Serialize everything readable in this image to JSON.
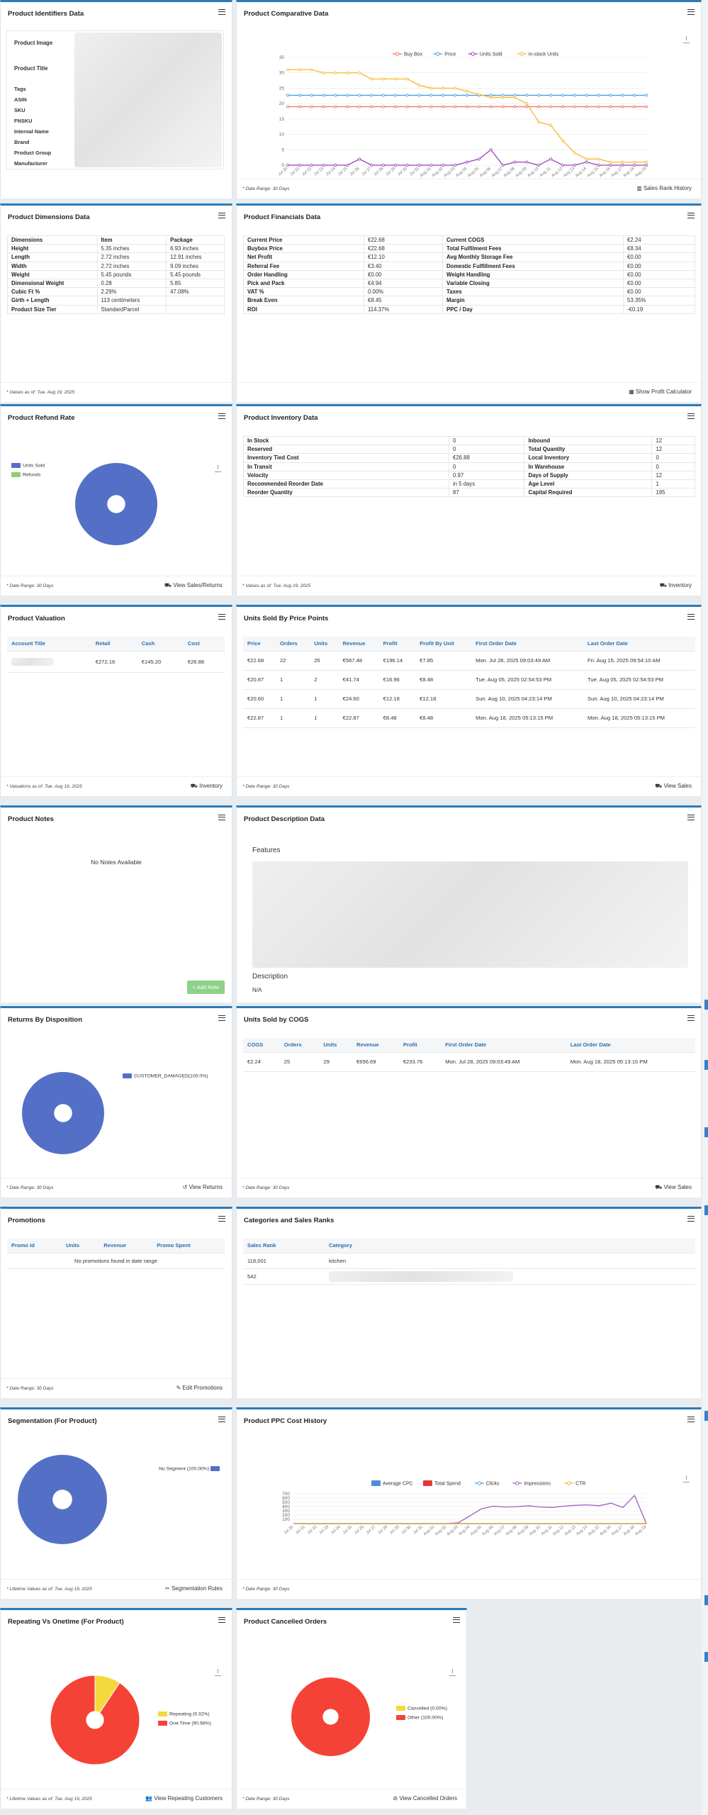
{
  "identifiers": {
    "title": "Product Identifiers Data",
    "image_label": "Product Image",
    "title_label": "Product Title",
    "rows": [
      "Tags",
      "ASIN",
      "SKU",
      "FNSKU",
      "Internal Name",
      "Brand",
      "Product Group",
      "Manufacturer"
    ]
  },
  "comparative": {
    "title": "Product Comparative Data",
    "date_range": "* Date Range: 30 Days",
    "link": "Sales Rank History"
  },
  "dimensions": {
    "title": "Product Dimensions Data",
    "headers": [
      "Dimensions",
      "Item",
      "Package"
    ],
    "rows": [
      [
        "Height",
        "5.35 inches",
        "6.93 inches"
      ],
      [
        "Length",
        "2.72 inches",
        "12.91 inches"
      ],
      [
        "Width",
        "2.72 inches",
        "9.09 inches"
      ],
      [
        "Weight",
        "5.45 pounds",
        "5.45 pounds"
      ],
      [
        "Dimensional Weight",
        "0.28",
        "5.85"
      ],
      [
        "Cubic Ft %",
        "2.29%",
        "47.08%"
      ],
      [
        "Girth + Length",
        "113 centimeters",
        ""
      ],
      [
        "Product Size Tier",
        "StandardParcel",
        ""
      ]
    ],
    "footer": "* Values as of: Tue. Aug 19, 2025"
  },
  "financials": {
    "title": "Product Financials Data",
    "rows": [
      [
        "Current Price",
        "€22.68",
        "Current COGS",
        "€2.24"
      ],
      [
        "Buybox Price",
        "€22.68",
        "Total Fulfilment Fees",
        "€8.34"
      ],
      [
        "Net Profit",
        "€12.10",
        "Avg Monthly Storage Fee",
        "€0.00"
      ],
      [
        "Referral Fee",
        "€3.40",
        "Domestic Fulfillment Fees",
        "€0.00"
      ],
      [
        "Order Handling",
        "€0.00",
        "Weight Handling",
        "€0.00"
      ],
      [
        "Pick and Pack",
        "€4.94",
        "Variable Closing",
        "€0.00"
      ],
      [
        "VAT %",
        "0.00%",
        "Taxes",
        "€0.00"
      ],
      [
        "Break Even",
        "€8.45",
        "Margin",
        "53.35%"
      ],
      [
        "ROI",
        "114.37%",
        "PPC / Day",
        "-€0.19"
      ]
    ],
    "button": "Show Profit Calculator"
  },
  "refund": {
    "title": "Product Refund Rate",
    "legend": [
      "Units Sold",
      "Refunds"
    ],
    "date_range": "* Date Range: 30 Days",
    "button": "View Sales/Returns"
  },
  "inventory": {
    "title": "Product Inventory Data",
    "rows": [
      [
        "In Stock",
        "0",
        "Inbound",
        "12"
      ],
      [
        "Reserved",
        "0",
        "Total Quantity",
        "12"
      ],
      [
        "Inventory Tied Cost",
        "€26.88",
        "Local Inventory",
        "0"
      ],
      [
        "In Transit",
        "0",
        "In Warehouse",
        "0"
      ],
      [
        "Velocity",
        "0.97",
        "Days of Supply",
        "12"
      ],
      [
        "Recommended Reorder Date",
        "in 5 days",
        "Age Level",
        "1"
      ],
      [
        "Reorder Quantity",
        "87",
        "Capital Required",
        "195"
      ]
    ],
    "footer": "* Values as of: Tue. Aug 19, 2025",
    "button": "Inventory"
  },
  "valuation": {
    "title": "Product Valuation",
    "headers": [
      "Account Title",
      "Retail",
      "Cash",
      "Cost"
    ],
    "row": [
      "€272.16",
      "€145.20",
      "€26.88"
    ],
    "footer": "* Valuations as of: Tue. Aug 19, 2025",
    "button": "Inventory"
  },
  "price_points": {
    "title": "Units Sold By Price Points",
    "headers": [
      "Price",
      "Orders",
      "Units",
      "Revenue",
      "Profit",
      "Profit By Unit",
      "First Order Date",
      "Last Order Date"
    ],
    "rows": [
      [
        "€22.68",
        "22",
        "25",
        "€567.48",
        "€196.14",
        "€7.85",
        "Mon. Jul 28, 2025 09:03:49 AM",
        "Fri. Aug 15, 2025 09:54:10 AM"
      ],
      [
        "€20.87",
        "1",
        "2",
        "€41.74",
        "€16.96",
        "€8.48",
        "Tue. Aug 05, 2025 02:54:53 PM",
        "Tue. Aug 05, 2025 02:54:53 PM"
      ],
      [
        "€20.60",
        "1",
        "1",
        "€24.60",
        "€12.18",
        "€12.18",
        "Sun. Aug 10, 2025 04:23:14 PM",
        "Sun. Aug 10, 2025 04:23:14 PM"
      ],
      [
        "€22.87",
        "1",
        "1",
        "€22.87",
        "€8.48",
        "€8.48",
        "Mon. Aug 18, 2025 05:13:15 PM",
        "Mon. Aug 18, 2025 05:13:15 PM"
      ]
    ],
    "date_range": "* Date Range: 30 Days",
    "button": "View Sales"
  },
  "notes": {
    "title": "Product Notes",
    "empty": "No Notes Available",
    "button": "+ Add Note"
  },
  "description": {
    "title": "Product Description Data",
    "features_label": "Features",
    "description_label": "Description",
    "description_value": "N/A"
  },
  "returns": {
    "title": "Returns By Disposition",
    "legend": "CUSTOMER_DAMAGED(100.0%)",
    "date_range": "* Date Range: 30 Days",
    "button": "View Returns"
  },
  "cogs": {
    "title": "Units Sold by COGS",
    "headers": [
      "COGS",
      "Orders",
      "Units",
      "Revenue",
      "Profit",
      "First Order Date",
      "Last Order Date"
    ],
    "row": [
      "€2.24",
      "25",
      "29",
      "€656.69",
      "€233.76",
      "Mon. Jul 28, 2025 09:03:49 AM",
      "Mon. Aug 18, 2025 05:13:15 PM"
    ],
    "date_range": "* Date Range: 30 Days",
    "button": "View Sales"
  },
  "promotions": {
    "title": "Promotions",
    "headers": [
      "Promo Id",
      "Units",
      "Revenue",
      "Promo Spent"
    ],
    "empty": "No promotions found in date range",
    "date_range": "* Date Range: 30 Days",
    "button": "Edit Promotions"
  },
  "categories": {
    "title": "Categories and Sales Ranks",
    "headers": [
      "Sales Rank",
      "Category"
    ],
    "rows": [
      [
        "118,001",
        "kitchen"
      ],
      [
        "542",
        ""
      ]
    ]
  },
  "segmentation": {
    "title": "Segmentation (For Product)",
    "legend": "No Segment (100.00%)",
    "footer": "* Lifetime Values as of: Tue. Aug 19, 2025",
    "button": "Segmentation Rules"
  },
  "ppc": {
    "title": "Product PPC Cost History",
    "legend": [
      "Average CPC",
      "Total Spend",
      "Clicks",
      "Impressions",
      "CTR"
    ],
    "date_range": "* Date Range: 30 Days"
  },
  "repeating": {
    "title": "Repeating Vs Onetime (For Product)",
    "legend": [
      "Repeating (9.32%)",
      "One Time (90.68%)"
    ],
    "footer": "* Lifetime Values as of: Tue. Aug 19, 2025",
    "button": "View Repeating Customers"
  },
  "cancelled": {
    "title": "Product Cancelled Orders",
    "legend": [
      "Cancelled (0.00%)",
      "Other (100.00%)"
    ],
    "date_range": "* Date Range: 30 Days",
    "button": "View Cancelled Orders"
  },
  "chart_data": [
    {
      "type": "line",
      "title": "",
      "x": [
        "Jul 20",
        "Jul 21",
        "Jul 22",
        "Jul 23",
        "Jul 24",
        "Jul 25",
        "Jul 26",
        "Jul 27",
        "Jul 28",
        "Jul 29",
        "Jul 30",
        "Jul 31",
        "Aug 01",
        "Aug 02",
        "Aug 03",
        "Aug 04",
        "Aug 05",
        "Aug 06",
        "Aug 07",
        "Aug 08",
        "Aug 09",
        "Aug 10",
        "Aug 11",
        "Aug 12",
        "Aug 13",
        "Aug 14",
        "Aug 15",
        "Aug 16",
        "Aug 17",
        "Aug 18",
        "Aug 19"
      ],
      "ylim": [
        0,
        35
      ],
      "yticks": [
        0,
        5,
        10,
        15,
        20,
        25,
        30,
        35
      ],
      "series": [
        {
          "name": "Buy Box",
          "color": "#ef6c5a",
          "values": [
            19,
            19,
            19,
            19,
            19,
            19,
            19,
            19,
            19,
            19,
            19,
            19,
            19,
            19,
            19,
            19,
            19,
            19,
            19,
            19,
            19,
            19,
            19,
            19,
            19,
            19,
            19,
            19,
            19,
            19,
            19
          ]
        },
        {
          "name": "Price",
          "color": "#4b9fe0",
          "values": [
            22.7,
            22.7,
            22.7,
            22.7,
            22.7,
            22.7,
            22.7,
            22.7,
            22.7,
            22.7,
            22.7,
            22.7,
            22.7,
            22.7,
            22.7,
            22.7,
            22.7,
            22.7,
            22.7,
            22.7,
            22.7,
            22.7,
            22.7,
            22.7,
            22.7,
            22.7,
            22.7,
            22.7,
            22.7,
            22.7,
            22.7
          ]
        },
        {
          "name": "Units Sold",
          "color": "#9b3fb5",
          "values": [
            0,
            0,
            0,
            0,
            0,
            0,
            2,
            0,
            0,
            0,
            0,
            0,
            0,
            0,
            0,
            1,
            2,
            5,
            0,
            1,
            1,
            0,
            2,
            0,
            0,
            1,
            0,
            0,
            0,
            0,
            0
          ]
        },
        {
          "name": "In-stock Units",
          "color": "#f5b82e",
          "values": [
            31,
            31,
            31,
            30,
            30,
            30,
            30,
            28,
            28,
            28,
            28,
            26,
            25,
            25,
            25,
            24,
            23,
            22,
            22,
            22,
            20,
            14,
            13,
            8,
            4,
            2,
            2,
            1,
            1,
            1,
            1
          ]
        }
      ]
    },
    {
      "type": "pie",
      "title": "",
      "series": [
        {
          "name": "Units Sold",
          "value": 100,
          "color": "#5470c6"
        },
        {
          "name": "Refunds",
          "value": 0,
          "color": "#91cc75"
        }
      ]
    },
    {
      "type": "pie",
      "title": "",
      "series": [
        {
          "name": "CUSTOMER_DAMAGED",
          "value": 100,
          "color": "#5470c6"
        }
      ]
    },
    {
      "type": "pie",
      "title": "",
      "series": [
        {
          "name": "No Segment",
          "value": 100,
          "color": "#5470c6"
        }
      ]
    },
    {
      "type": "line",
      "title": "",
      "x": [
        "Jul 20",
        "Jul 21",
        "Jul 22",
        "Jul 23",
        "Jul 24",
        "Jul 25",
        "Jul 26",
        "Jul 27",
        "Jul 28",
        "Jul 29",
        "Jul 30",
        "Jul 31",
        "Aug 01",
        "Aug 02",
        "Aug 03",
        "Aug 04",
        "Aug 05",
        "Aug 06",
        "Aug 07",
        "Aug 08",
        "Aug 09",
        "Aug 10",
        "Aug 11",
        "Aug 12",
        "Aug 13",
        "Aug 14",
        "Aug 15",
        "Aug 16",
        "Aug 17",
        "Aug 18",
        "Aug 19"
      ],
      "ylim": [
        0,
        700
      ],
      "yticks": [
        100,
        200,
        300,
        400,
        500,
        600,
        700
      ],
      "series": [
        {
          "name": "Average CPC",
          "color": "#4a90d9",
          "values": [
            0,
            0,
            0,
            0,
            0,
            0,
            0,
            0,
            0,
            0,
            0,
            0,
            0,
            0,
            0,
            0,
            0,
            0,
            0,
            0,
            0,
            0,
            0,
            0,
            0,
            0,
            0,
            0,
            0,
            0,
            0
          ]
        },
        {
          "name": "Total Spend",
          "color": "#e53935",
          "values": [
            0,
            0,
            0,
            0,
            0,
            0,
            0,
            0,
            0,
            0,
            0,
            0,
            0,
            0,
            0,
            0,
            0,
            0,
            0,
            0,
            0,
            0,
            0,
            0,
            0,
            0,
            0,
            0,
            0,
            0,
            0
          ]
        },
        {
          "name": "Clicks",
          "color": "#4b9fe0",
          "values": [
            0,
            0,
            0,
            0,
            0,
            0,
            0,
            0,
            0,
            0,
            0,
            0,
            0,
            0,
            0,
            0,
            0,
            0,
            0,
            0,
            0,
            0,
            0,
            0,
            0,
            0,
            0,
            0,
            0,
            0,
            0
          ]
        },
        {
          "name": "Impressions",
          "color": "#9b5fc0",
          "values": [
            0,
            0,
            0,
            0,
            0,
            0,
            0,
            0,
            0,
            0,
            0,
            0,
            0,
            0,
            20,
            180,
            350,
            410,
            390,
            400,
            420,
            390,
            380,
            410,
            430,
            440,
            420,
            480,
            380,
            660,
            0
          ]
        },
        {
          "name": "CTR",
          "color": "#f5b82e",
          "values": [
            0,
            0,
            0,
            0,
            0,
            0,
            0,
            0,
            0,
            0,
            0,
            0,
            0,
            0,
            0,
            0,
            0,
            0,
            0,
            0,
            0,
            0,
            0,
            0,
            0,
            0,
            0,
            0,
            0,
            0,
            0
          ]
        }
      ]
    },
    {
      "type": "pie",
      "title": "",
      "series": [
        {
          "name": "Repeating",
          "value": 9.32,
          "color": "#f5d83c"
        },
        {
          "name": "One Time",
          "value": 90.68,
          "color": "#f44336"
        }
      ]
    },
    {
      "type": "pie",
      "title": "",
      "series": [
        {
          "name": "Cancelled",
          "value": 0,
          "color": "#f5d83c"
        },
        {
          "name": "Other",
          "value": 100,
          "color": "#f44336"
        }
      ]
    }
  ]
}
